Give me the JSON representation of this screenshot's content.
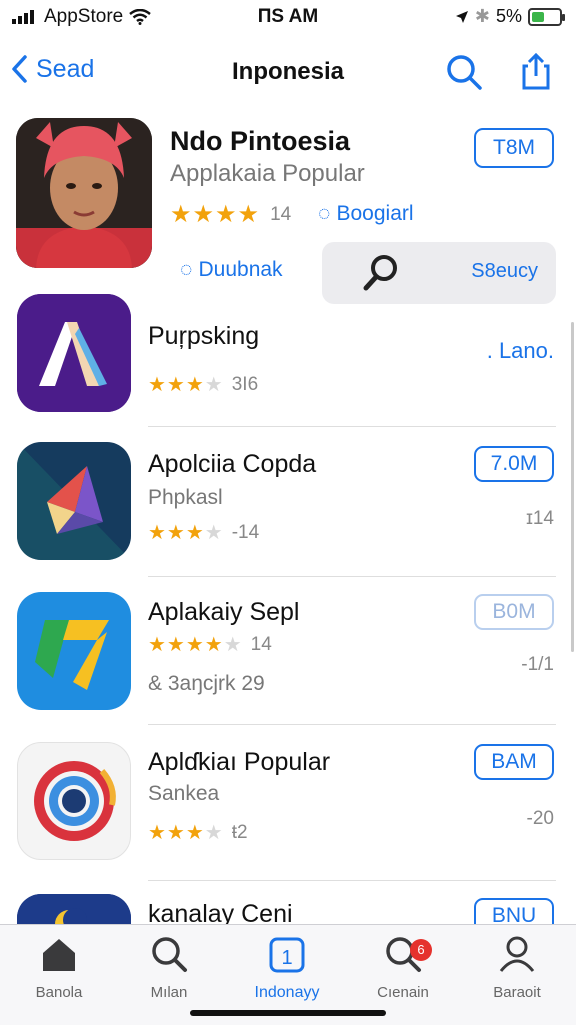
{
  "status_bar": {
    "carrier": "AppStore",
    "time": "ПS AM",
    "battery_pct": "5%"
  },
  "nav": {
    "back_label": "Sead",
    "title": "Inponesia"
  },
  "featured": {
    "name": "Ndo Pintoesia",
    "subtitle": "Applakaia Popular",
    "rating_count": "14",
    "link1": "Boogiarl",
    "link2": "Duubnak",
    "button": "T8M",
    "search_label": "S8eucy"
  },
  "apps": [
    {
      "name": "Puŗpsking",
      "rating": "3I6",
      "side": ". Lano."
    },
    {
      "name": "Apolciia Copda",
      "line2": "Phpkasl",
      "rating": "-14",
      "button": "7.0M",
      "side": "ɪ14"
    },
    {
      "name": "Aplakaiy Sepl",
      "rating": "14",
      "line3": "& 3aŋcjrk 29",
      "button": "B0M",
      "side": "-1/1"
    },
    {
      "name": "Aplɗkiaı Popular",
      "line2": "Sankea",
      "rating": "ŧ2",
      "button": "BAM",
      "side": "-20"
    },
    {
      "name": "kanalay Ceni",
      "button": "BNU"
    }
  ],
  "tabs": [
    {
      "label": "Banola"
    },
    {
      "label": "Mılan"
    },
    {
      "label": "Indonayy"
    },
    {
      "label": "Cıenain",
      "badge": "6"
    },
    {
      "label": "Baraoit"
    }
  ],
  "colors": {
    "accent": "#1a73e8",
    "star": "#f2a20c",
    "badge": "#e5322d"
  }
}
